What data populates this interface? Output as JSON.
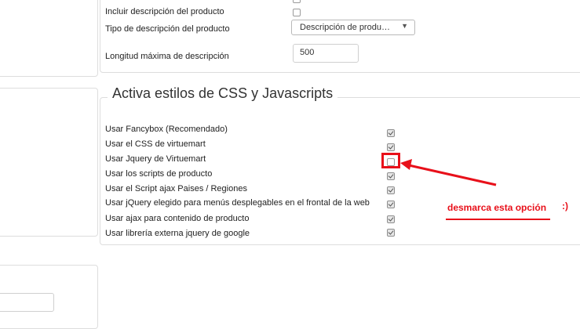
{
  "product_settings": {
    "include_description_label": "Incluir descripción del producto",
    "include_description_checked": false,
    "description_type_label": "Tipo de descripción del producto",
    "description_type_value": "Descripción de produ…",
    "max_description_length_label": "Longitud máxima de descripción",
    "max_description_length_value": "500"
  },
  "css_js_section": {
    "title": "Activa estilos de CSS y Javascripts",
    "items": [
      {
        "label": "Usar Fancybox (Recomendado)",
        "checked": true
      },
      {
        "label": "Usar el CSS de virtuemart",
        "checked": true
      },
      {
        "label": "Usar Jquery de Virtuemart",
        "checked": false
      },
      {
        "label": "Usar los scripts de producto",
        "checked": true
      },
      {
        "label": "Usar el Script ajax Paises / Regiones",
        "checked": true
      },
      {
        "label": "Usar jQuery elegido para menús desplegables en el frontal de la web",
        "checked": true
      },
      {
        "label": "Usar ajax para contenido de producto",
        "checked": true
      },
      {
        "label": "Usar librería externa jquery de google",
        "checked": true
      }
    ]
  },
  "annotation": {
    "text": "desmarca esta opción",
    "emoticon": ":)",
    "color": "#e8101a"
  }
}
